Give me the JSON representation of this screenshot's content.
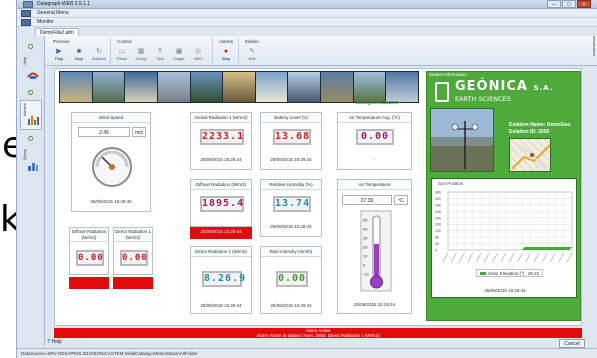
{
  "overlay_text": {
    "letter_e": "e",
    "letter_k": "k"
  },
  "window": {
    "title": "Datagraph-WEB 2.5.1.1",
    "minimize": "–",
    "maximize": "□",
    "close": "×"
  },
  "menus": {
    "general": "General Menu",
    "monitor": "Monitor"
  },
  "document_tab": "DemoFile2.alm",
  "sidebar": {
    "items": [
      "Map",
      "Monitor",
      "Query"
    ]
  },
  "ribbon": {
    "groups": [
      {
        "name": "Process",
        "buttons": [
          {
            "label": "Play",
            "icon": "play-icon",
            "glyph": "▶"
          },
          {
            "label": "Stop",
            "icon": "stop-icon",
            "glyph": "■"
          },
          {
            "label": "Autorun",
            "icon": "autorun-icon",
            "glyph": "↻"
          }
        ]
      },
      {
        "name": "Control",
        "buttons": [
          {
            "label": "Panel",
            "icon": "panel-icon",
            "glyph": "▭"
          },
          {
            "label": "Group",
            "icon": "group-icon",
            "glyph": "▦"
          },
          {
            "label": "Text",
            "icon": "text-icon",
            "glyph": "T"
          },
          {
            "label": "Image",
            "icon": "image-icon",
            "glyph": "▣"
          },
          {
            "label": "VMO",
            "icon": "vmo-icon",
            "glyph": "◎"
          }
        ]
      },
      {
        "name": "Alarms",
        "buttons": [
          {
            "label": "Stop",
            "icon": "alarm-stop-icon",
            "glyph": "●"
          }
        ]
      },
      {
        "name": "Edition",
        "buttons": [
          {
            "label": "Edit",
            "icon": "edit-icon",
            "glyph": "✎"
          }
        ]
      }
    ]
  },
  "information_tab": "Information",
  "content": {
    "website": "www.geonica.com",
    "tiles": {
      "wind_speed": {
        "title": "Wind Speed",
        "value": "2.45",
        "unit": "m/s",
        "date": "25/09/2015 15:29:45",
        "gauge_fraction": 0.25
      },
      "global_radiation": {
        "title": "Global Radiation 1 (W/m2)",
        "value": "2233.1",
        "date": "25/09/2015 15:29:44"
      },
      "battery": {
        "title": "Battery Level (V)",
        "value": "13.68",
        "date": "25/09/2015 15:29:44"
      },
      "air_temp_avg": {
        "title": "Air Temperature Avg. (ºC)",
        "value": "0.00",
        "date": "-"
      },
      "diffuse_radiation": {
        "title": "Diffuse Radiation (W/m2)",
        "value": "1895.4",
        "date": "25/09/2015 15:29:44"
      },
      "humidity": {
        "title": "Relative Humidity (%)",
        "value": "13.74",
        "date": "25/09/2015 15:29:44"
      },
      "air_temp": {
        "title": "Air Temperature",
        "value": "27.39",
        "unit": "ºC",
        "date": "25/09/2015 15:29:44",
        "fill_fraction": 0.55,
        "scale": [
          "50",
          "40",
          "30",
          "20",
          "10",
          "0",
          "-10"
        ]
      },
      "diffuse_radiation_small": {
        "title": "Diffuse Radiation (W/m2)",
        "value": "0.00"
      },
      "direct_radiation_small": {
        "title": "Direct Radiation 1 (W/m2)",
        "value": "0.00"
      },
      "direct_radiation": {
        "title": "Direct Radiation 1 (W/m2)",
        "value": "8.26.9",
        "date": "25/09/2015 15:29:44"
      },
      "rain": {
        "title": "Rain intensity (mm/h)",
        "value": "0.00",
        "date": "25/09/2015 15:29:44"
      }
    },
    "station": {
      "header": "Station Information",
      "brand": "GEÓNICA",
      "brand_suffix": "S.A.",
      "brand_sub": "EARTH SCIENCES",
      "name_line": "Estation Name: DemoGeo",
      "id_line": "Estation ID: 3050",
      "sun_title": "Sun Position",
      "sun_legend": "Solar Elevation (º) : 28.22",
      "sun_date": "25/09/2015 15:29:44",
      "sun_yticks": [
        "360",
        "320",
        "280",
        "240",
        "200",
        "160",
        "120",
        "80",
        "40",
        "0"
      ]
    }
  },
  "alarm": {
    "line1": "Alarm Active",
    "line2": "Alarm Active at station: Num. 3050. Direct Radiation 1 (W/m2)"
  },
  "footer": {
    "help": "Help",
    "cancel": "Cancel",
    "status": "DataSource=SRV-GESAPROLI01\\GEONICASTEM;InitialCatalog=MeteoStationAllFolder"
  },
  "colors": {
    "alarm_red": "#e20b0b",
    "brand_green": "#4faa3c",
    "lcd_red": "#d01e1e"
  }
}
